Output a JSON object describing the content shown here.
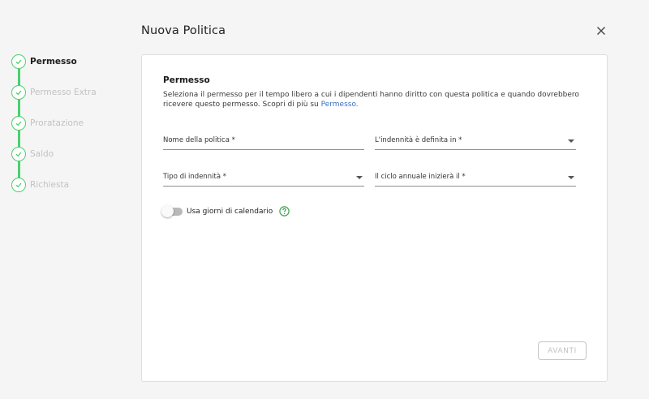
{
  "dialog": {
    "title": "Nuova Politica"
  },
  "steps": [
    {
      "label": "Permesso",
      "active": true,
      "completed": true
    },
    {
      "label": "Permesso Extra",
      "active": false,
      "completed": true
    },
    {
      "label": "Proratazione",
      "active": false,
      "completed": true
    },
    {
      "label": "Saldo",
      "active": false,
      "completed": true
    },
    {
      "label": "Richiesta",
      "active": false,
      "completed": true
    }
  ],
  "section": {
    "title": "Permesso",
    "description": "Seleziona il permesso per il tempo libero a cui i dipendenti hanno diritto con questa politica e quando dovrebbero ricevere questo permesso. Scopri di più su ",
    "link_text": "Permesso."
  },
  "form": {
    "policy_name": "Nome della politica *",
    "allowance_defined_in": "L'indennità è definita in *",
    "allowance_type": "Tipo di indennità *",
    "annual_cycle_start": "Il ciclo annuale inizierà il *"
  },
  "calendar_toggle": {
    "label": "Usa giorni di calendario",
    "enabled": false
  },
  "actions": {
    "next_label": "AVANTI"
  },
  "colors": {
    "accent_green": "#4ad06e",
    "link_blue": "#3a6fc2",
    "help_green": "#3fa34d"
  }
}
